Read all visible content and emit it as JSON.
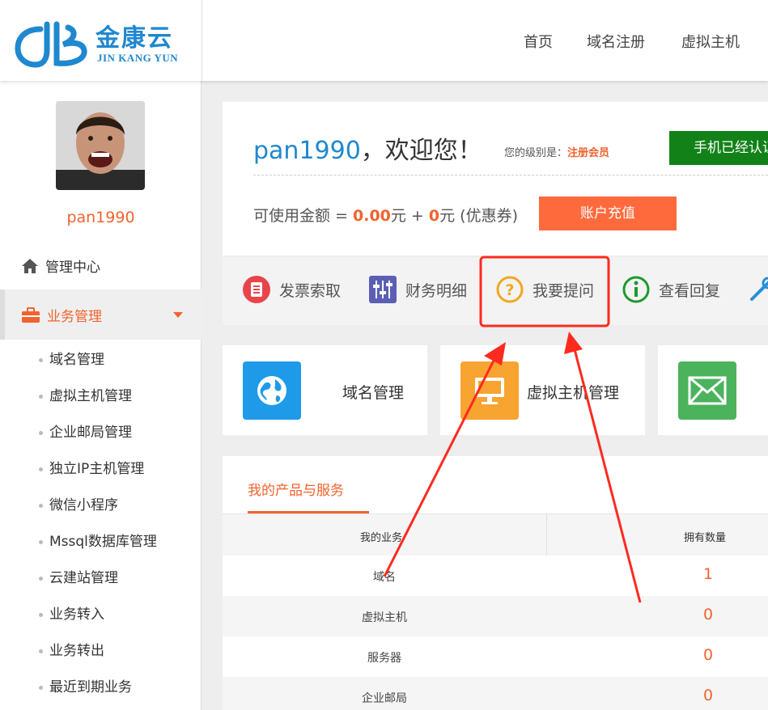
{
  "header": {
    "logo_text": "金康云",
    "logo_sub": "JIN KANG YUN",
    "nav": [
      "首页",
      "域名注册",
      "虚拟主机"
    ]
  },
  "sidebar": {
    "username": "pan1990",
    "home_label": "管理中心",
    "biz_label": "业务管理",
    "sub_items": [
      "域名管理",
      "虚拟主机管理",
      "企业邮局管理",
      "独立IP主机管理",
      "微信小程序",
      "Mssql数据库管理",
      "云建站管理",
      "业务转入",
      "业务转出",
      "最近到期业务"
    ]
  },
  "welcome": {
    "username": "pan1990",
    "greeting": "，欢迎您！",
    "level_prefix": "您的级别是：",
    "level": "注册会员",
    "phone_button": "手机已经认证",
    "balance_label": "可使用金额 = ",
    "balance_amount": "0.00",
    "balance_unit": "元 + ",
    "coupon_amount": "0",
    "coupon_unit": "元 (优惠券)",
    "recharge_button": "账户充值"
  },
  "toolbar": {
    "items": [
      "发票索取",
      "财务明细",
      "我要提问",
      "查看回复"
    ]
  },
  "cards": [
    "域名管理",
    "虚拟主机管理"
  ],
  "products": {
    "tab": "我的产品与服务",
    "col_business": "我的业务",
    "col_count": "拥有数量",
    "rows": [
      {
        "name": "域名",
        "count": "1"
      },
      {
        "name": "虚拟主机",
        "count": "0"
      },
      {
        "name": "服务器",
        "count": "0"
      },
      {
        "name": "企业邮局",
        "count": "0"
      }
    ]
  },
  "colors": {
    "brand_blue": "#1f88cf",
    "accent_orange": "#f0632e",
    "green": "#128218",
    "annotation_red": "#ff2a1f"
  },
  "icons": [
    "house-icon",
    "briefcase-icon",
    "invoice-icon",
    "sliders-icon",
    "question-icon",
    "info-icon",
    "wrench-icon",
    "globe-icon",
    "monitor-icon",
    "mail-icon"
  ]
}
